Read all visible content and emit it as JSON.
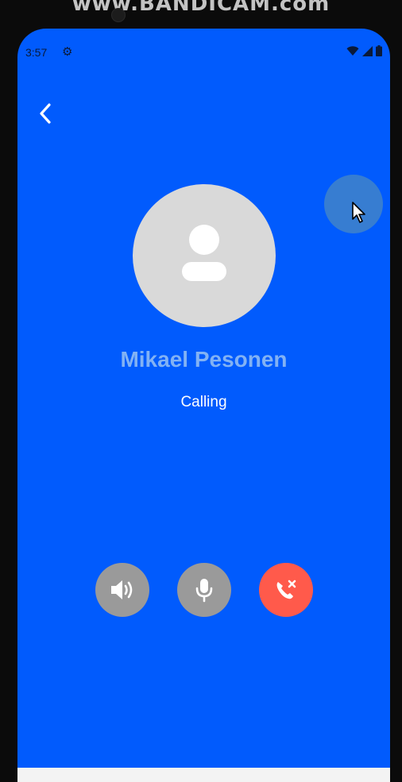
{
  "watermark": {
    "text": "www.BANDICAM.com"
  },
  "status_bar": {
    "time": "3:57",
    "icons": [
      "settings-gear-icon",
      "wifi-icon",
      "signal-icon",
      "battery-icon"
    ]
  },
  "call": {
    "contact_name": "Mikael Pesonen",
    "status": "Calling"
  },
  "controls": [
    {
      "name": "speaker-button",
      "icon": "speaker-icon"
    },
    {
      "name": "mute-button",
      "icon": "microphone-icon"
    },
    {
      "name": "end-call-button",
      "icon": "phone-hangup-icon"
    }
  ],
  "colors": {
    "background": "#015BFD",
    "avatar": "#D9D9D9",
    "contact_name": "#82B2F4",
    "control_neutral": "#9A9A9A",
    "control_end": "#FF5A4B"
  }
}
